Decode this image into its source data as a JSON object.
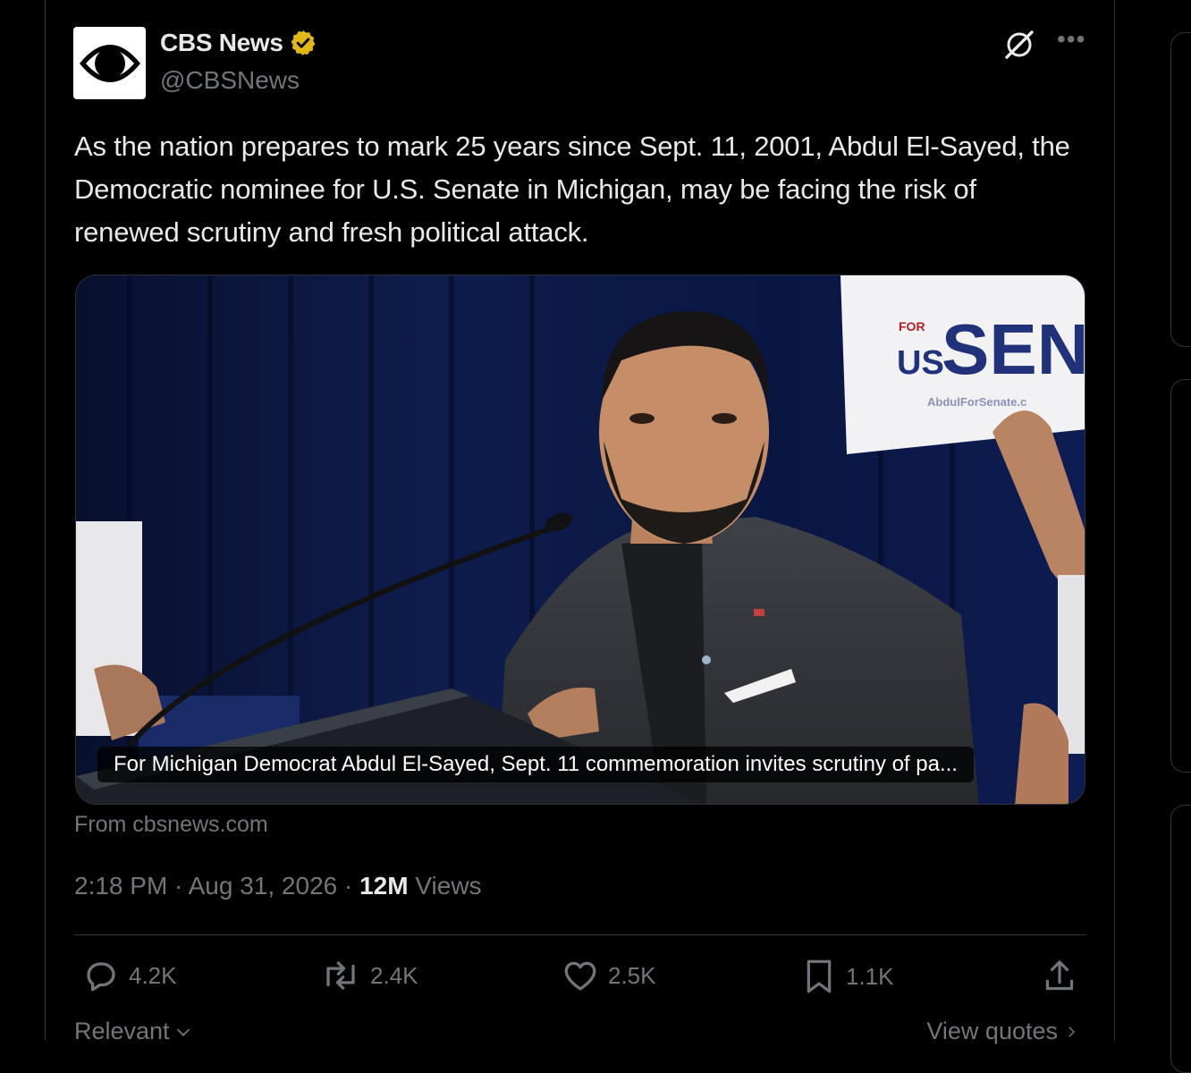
{
  "author": {
    "name": "CBS News",
    "handle": "@CBSNews",
    "verified": true,
    "badge_color": "#e2b719"
  },
  "tweet": {
    "text": "As the nation prepares to mark 25 years since Sept. 11, 2001, Abdul El-Sayed, the Democratic nominee for U.S. Senate in Michigan, may be facing the risk of renewed scrutiny and fresh political attack."
  },
  "card": {
    "image_description": "Man in a dark blazer speaking at a podium with microphone, campaign sign reading 'FOR US SENATE' in background",
    "sign_text": {
      "for": "FOR",
      "us": "US",
      "senate": "SENA",
      "url": "AbdulForSenate.c"
    },
    "caption": "For Michigan Democrat Abdul El-Sayed, Sept. 11 commemoration invites scrutiny of pa...",
    "source": "From cbsnews.com"
  },
  "meta": {
    "time": "2:18 PM",
    "separator": " · ",
    "date": "Aug 31, 2026",
    "views_count": "12M",
    "views_label": " Views"
  },
  "actions": {
    "replies": "4.2K",
    "reposts": "2.4K",
    "likes": "2.5K",
    "bookmarks": "1.1K"
  },
  "footer": {
    "sort_label": "Relevant",
    "quotes_label": "View quotes"
  },
  "icons": [
    "cbs-eye-icon",
    "verified-badge-icon",
    "grok-icon",
    "more-icon",
    "reply-icon",
    "repost-icon",
    "like-icon",
    "bookmark-icon",
    "share-icon",
    "chevron-down-icon",
    "chevron-right-icon"
  ],
  "colors": {
    "background": "#000000",
    "text_primary": "#e7e9ea",
    "text_secondary": "#71767b",
    "border": "#2f3336"
  }
}
